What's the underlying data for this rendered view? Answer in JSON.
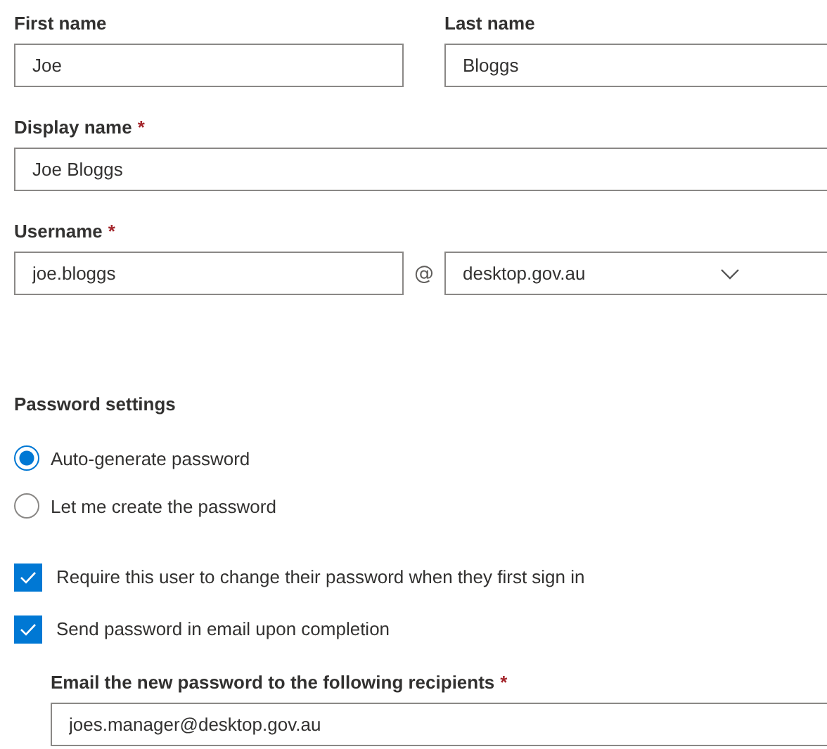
{
  "name_row": [
    {
      "label": "First name",
      "value": "Joe"
    },
    {
      "label": "Last name",
      "value": "Bloggs"
    }
  ],
  "display_name": {
    "label": "Display name",
    "required_mark": "*",
    "value": "Joe Bloggs"
  },
  "username": {
    "label": "Username",
    "required_mark": "*",
    "value": "joe.bloggs",
    "separator": "@",
    "domain": "desktop.gov.au"
  },
  "password_settings": {
    "heading": "Password settings",
    "radios": [
      {
        "label": "Auto-generate password",
        "selected": true
      },
      {
        "label": "Let me create the password",
        "selected": false
      }
    ],
    "checkboxes": [
      {
        "label": "Require this user to change their password when they first sign in",
        "checked": true
      },
      {
        "label": "Send password in email upon completion",
        "checked": true
      }
    ],
    "recipients": {
      "label": "Email the new password to the following recipients",
      "required_mark": "*",
      "value": "joes.manager@desktop.gov.au"
    }
  }
}
